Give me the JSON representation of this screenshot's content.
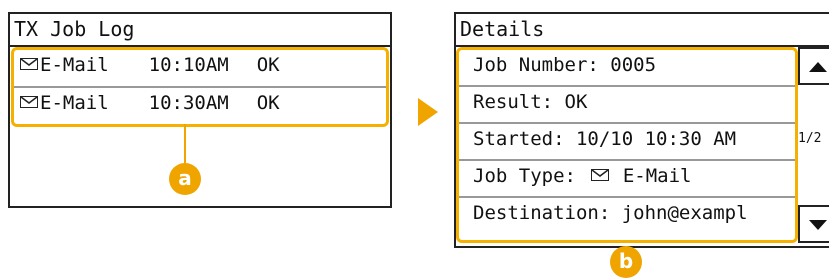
{
  "left_screen": {
    "title": "TX Job Log",
    "entries": [
      {
        "icon": "envelope-icon",
        "type": "E-Mail",
        "time": "10:10AM",
        "status": "OK"
      },
      {
        "icon": "envelope-icon",
        "type": "E-Mail",
        "time": "10:30AM",
        "status": "OK"
      }
    ]
  },
  "right_screen": {
    "title": "Details",
    "fields": [
      {
        "text": "Job Number: 0005"
      },
      {
        "text": "Result: OK"
      },
      {
        "text": "Started: 10/10 10:30 AM"
      },
      {
        "label": "Job Type:",
        "icon": "envelope-icon",
        "value": "E-Mail"
      },
      {
        "text": "Destination: john@exampl"
      }
    ],
    "page_indicator": "1/2"
  },
  "callouts": {
    "a": "a",
    "b": "b"
  },
  "colors": {
    "accent": "#f0a400",
    "border": "#222222"
  }
}
